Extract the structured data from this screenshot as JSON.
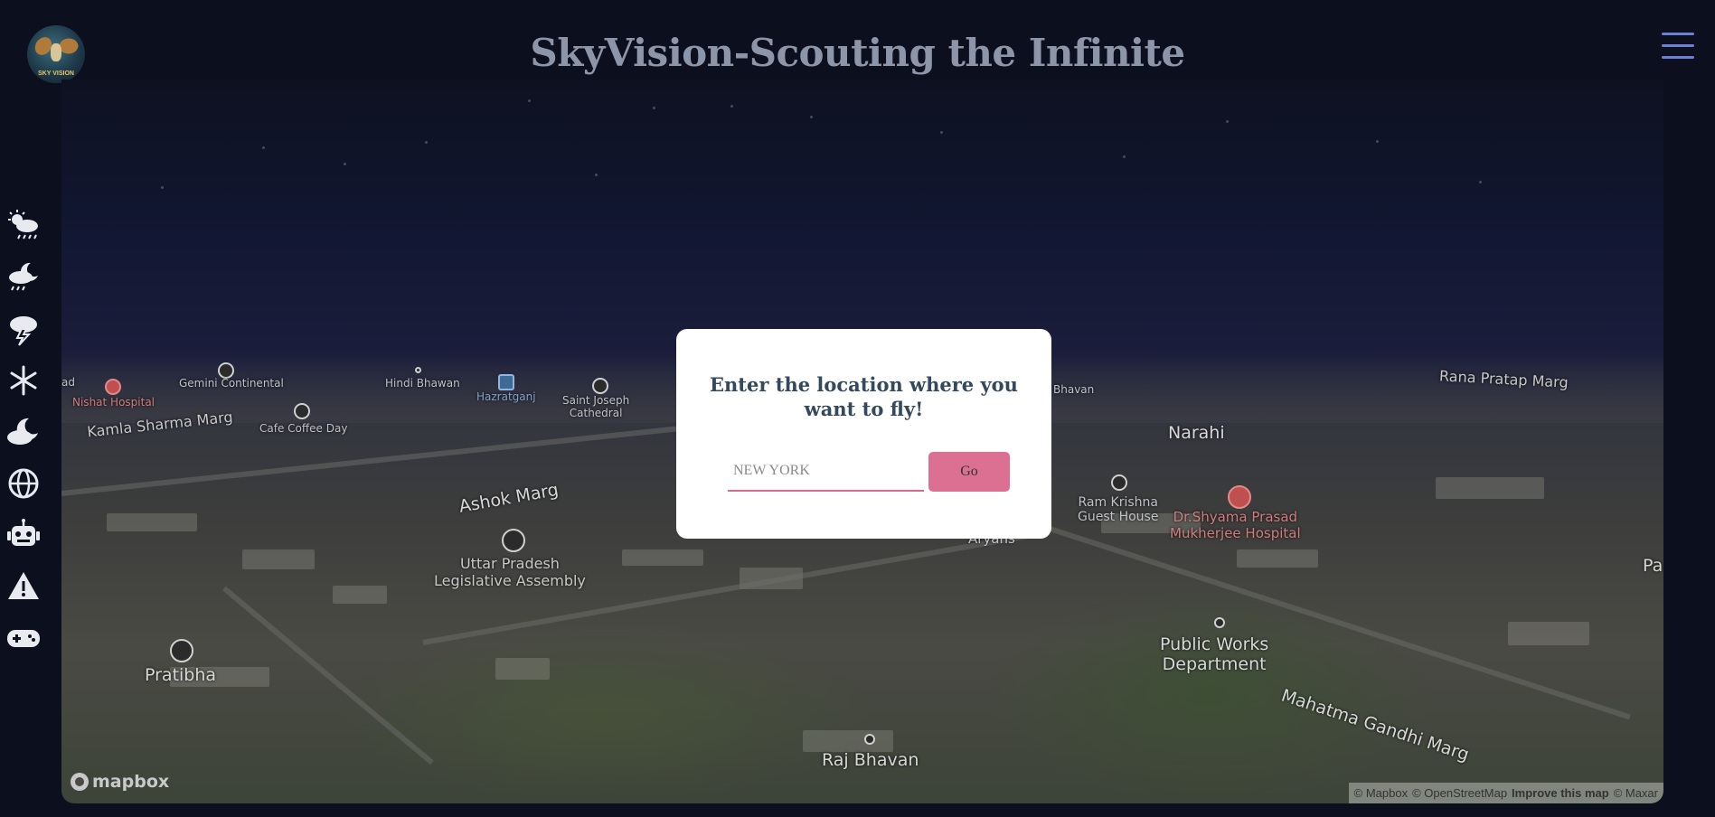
{
  "header": {
    "title": "SkyVision-Scouting the Infinite",
    "logo_text": "SKY VISION",
    "menu_icon": "hamburger-menu-icon"
  },
  "sidebar": {
    "items": [
      {
        "name": "sun-rain-icon"
      },
      {
        "name": "moon-rain-icon"
      },
      {
        "name": "thunderstorm-icon"
      },
      {
        "name": "snowflake-icon"
      },
      {
        "name": "moon-cloud-icon"
      },
      {
        "name": "globe-icon"
      },
      {
        "name": "robot-icon"
      },
      {
        "name": "warning-icon"
      },
      {
        "name": "gamepad-icon"
      }
    ]
  },
  "map": {
    "labels": {
      "ad": "ad",
      "nishat": "Nishat Hospital",
      "gemini": "Gemini Continental",
      "hindi": "Hindi Bhawan",
      "hazratganj": "Hazratganj",
      "saint_joseph": "Saint Joseph\nCathedral",
      "bhavan": "Bhavan",
      "rana_pratap": "Rana Pratap Marg",
      "kamla": "Kamla Sharma Marg",
      "cafe": "Cafe Coffee Day",
      "narahi": "Narahi",
      "ashok": "Ashok Marg",
      "ram_krishna": "Ram Krishna\nGuest House",
      "shyama": "Dr.Shyama Prasad\nMukherjee Hospital",
      "aryans": "Aryans",
      "pa": "Pa",
      "uttar": "Uttar Pradesh\nLegislative Assembly",
      "pratibha": "Pratibha",
      "public_works": "Public Works\nDepartment",
      "mahatma": "Mahatma Gandhi Marg",
      "raj_bhavan": "Raj Bhavan"
    },
    "logo": "mapbox",
    "attribution": {
      "mapbox": "© Mapbox",
      "osm": "© OpenStreetMap",
      "improve": "Improve this map",
      "maxar": "© Maxar"
    }
  },
  "modal": {
    "heading": "Enter the location where you want to fly!",
    "input_placeholder": "NEW YORK",
    "go_label": "Go"
  },
  "colors": {
    "background": "#0b0f1e",
    "accent": "#db7093",
    "heading": "#34495e",
    "menu": "#6f7fd6"
  }
}
